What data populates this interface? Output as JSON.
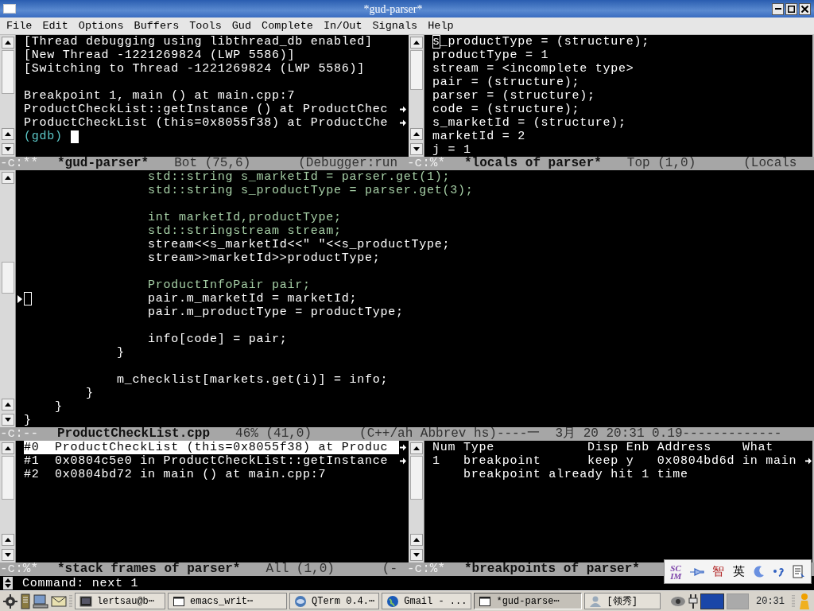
{
  "window": {
    "title": "*gud-parser*"
  },
  "menu": [
    "File",
    "Edit",
    "Options",
    "Buffers",
    "Tools",
    "Gud",
    "Complete",
    "In/Out",
    "Signals",
    "Help"
  ],
  "gud_pane": {
    "lines": [
      {
        "kind": "output",
        "text": "[Thread debugging using libthread_db enabled]",
        "truncated": false
      },
      {
        "kind": "output",
        "text": "[New Thread -1221269824 (LWP 5586)]",
        "truncated": false
      },
      {
        "kind": "output",
        "text": "[Switching to Thread -1221269824 (LWP 5586)]",
        "truncated": false
      },
      {
        "kind": "blank"
      },
      {
        "kind": "output",
        "text": "Breakpoint 1, main () at main.cpp:7",
        "truncated": false
      },
      {
        "kind": "output",
        "text": "ProductCheckList::getInstance () at ProductChec",
        "truncated": true
      },
      {
        "kind": "output",
        "text": "ProductCheckList (this=0x8055f38) at ProductChe",
        "truncated": true
      },
      {
        "kind": "prompt",
        "text": "(gdb)"
      }
    ]
  },
  "locals_pane": {
    "lines": [
      {
        "text": "s_productType = (structure);",
        "cursor": true
      },
      {
        "text": "productType = 1",
        "cursor": false
      },
      {
        "text": "stream = <incomplete type>",
        "cursor": false
      },
      {
        "text": "pair = (structure);",
        "cursor": false
      },
      {
        "text": "parser = (structure);",
        "cursor": false
      },
      {
        "text": "code = (structure);",
        "cursor": false
      },
      {
        "text": "s_marketId = (structure);",
        "cursor": false
      },
      {
        "text": "marketId = 2",
        "cursor": false
      },
      {
        "text": "j = 1",
        "cursor": false
      }
    ]
  },
  "modeline_top": [
    {
      "flags": "-c:**",
      "buffer": "*gud-parser*",
      "position": "Bot (75,6)",
      "mode": "(Debugger:run"
    },
    {
      "flags": "-c:%*",
      "buffer": "*locals of parser*",
      "position": "Top (1,0)",
      "mode": "(Locals"
    }
  ],
  "source_pane": {
    "lines": [
      {
        "kind": "type",
        "text": "                std::string s_marketId = parser.get(1);",
        "current": false
      },
      {
        "kind": "type",
        "text": "                std::string s_productType = parser.get(3);",
        "current": false
      },
      {
        "kind": "blank"
      },
      {
        "kind": "type",
        "text": "                int marketId,productType;",
        "current": false
      },
      {
        "kind": "type",
        "text": "                std::stringstream stream;",
        "current": false
      },
      {
        "kind": "plain",
        "text": "                stream<<s_marketId<<\" \"<<s_productType;",
        "current": false
      },
      {
        "kind": "plain",
        "text": "                stream>>marketId>>productType;",
        "current": false
      },
      {
        "kind": "blank"
      },
      {
        "kind": "type",
        "text": "                ProductInfoPair pair;",
        "current": false
      },
      {
        "kind": "plain",
        "text": "                pair.m_marketId = marketId;",
        "current": true
      },
      {
        "kind": "plain",
        "text": "                pair.m_productType = productType;",
        "current": false
      },
      {
        "kind": "blank"
      },
      {
        "kind": "plain",
        "text": "                info[code] = pair;",
        "current": false
      },
      {
        "kind": "plain",
        "text": "            }",
        "current": false
      },
      {
        "kind": "blank"
      },
      {
        "kind": "plain",
        "text": "            m_checklist[markets.get(i)] = info;",
        "current": false
      },
      {
        "kind": "plain",
        "text": "        }",
        "current": false
      },
      {
        "kind": "plain",
        "text": "    }",
        "current": false
      },
      {
        "kind": "plain",
        "text": "}",
        "current": false
      }
    ]
  },
  "modeline_source": {
    "flags": "-c:--",
    "buffer": "ProductCheckList.cpp",
    "position": "46% (41,0)",
    "mode": "(C++/ah Abbrev hs)----一  3月 20 20:31 0.19-------------"
  },
  "stack_pane": {
    "frames": [
      {
        "text": "#0  ProductCheckList (this=0x8055f38) at Produc",
        "selected": true,
        "truncated": true
      },
      {
        "text": "#1  0x0804c5e0 in ProductCheckList::getInstance",
        "selected": false,
        "truncated": true
      },
      {
        "text": "#2  0x0804bd72 in main () at main.cpp:7",
        "selected": false,
        "truncated": false
      }
    ]
  },
  "breakpoints_pane": {
    "header": "Num Type            Disp Enb Address    What",
    "rows": [
      {
        "text": "1   breakpoint      keep y   0x0804bd6d in main",
        "truncated": true
      },
      {
        "text": "    breakpoint already hit 1 time",
        "truncated": false
      }
    ]
  },
  "modeline_bottom": [
    {
      "flags": "-c:%*",
      "buffer": "*stack frames of parser*",
      "position": "All (1,0)",
      "mode": "(-"
    },
    {
      "flags": "-c:%*",
      "buffer": "*breakpoints of parser*"
    }
  ],
  "minibuffer": "Command: next 1",
  "ime_toolbar": {
    "logo": [
      "SC",
      "IM"
    ],
    "input_mode": "智",
    "language": "英"
  },
  "taskbar": {
    "tasks": [
      {
        "label": "lertsau@b⋯",
        "selected": false
      },
      {
        "label": "emacs_writ⋯",
        "selected": false
      },
      {
        "label": "QTerm 0.4.⋯",
        "selected": false
      },
      {
        "label": "Gmail - ...",
        "selected": false
      },
      {
        "label": "*gud-parse⋯",
        "selected": true
      },
      {
        "label": "[领秀]",
        "selected": false
      }
    ],
    "clock": "20:31"
  }
}
